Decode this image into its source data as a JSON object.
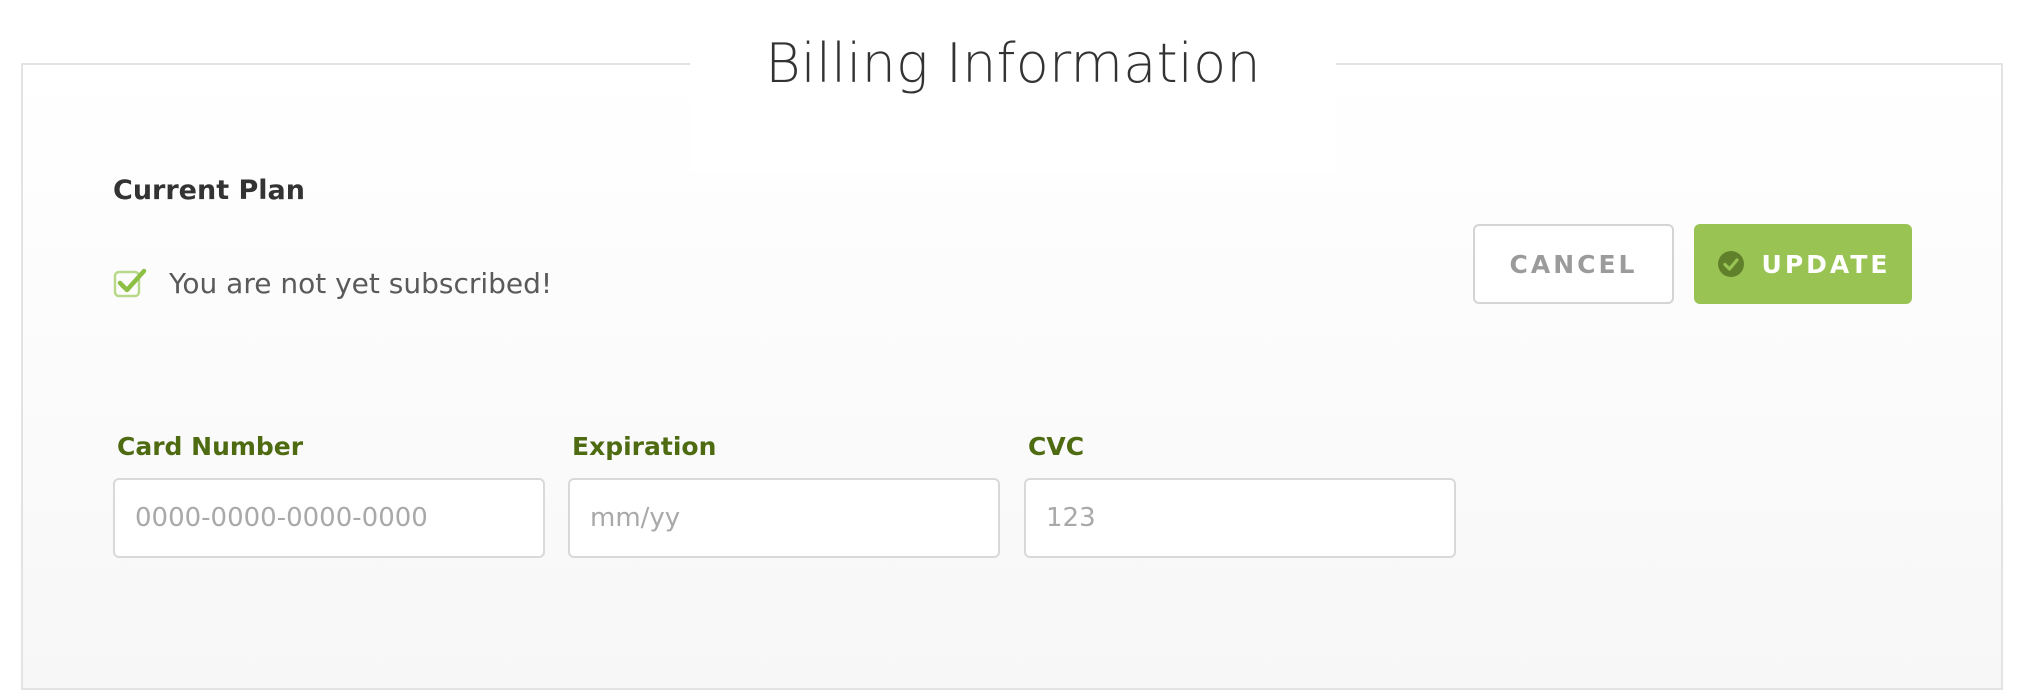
{
  "header": {
    "title": "Billing Information"
  },
  "plan": {
    "heading": "Current Plan",
    "status_text": "You are not yet subscribed!",
    "status_icon": "checkbox-check-icon"
  },
  "actions": {
    "cancel_label": "CANCEL",
    "update_label": "UPDATE",
    "update_icon": "check-circle-icon"
  },
  "form": {
    "card_number": {
      "label": "Card Number",
      "value": "",
      "placeholder": "0000-0000-0000-0000"
    },
    "expiration": {
      "label": "Expiration",
      "value": "",
      "placeholder": "mm/yy"
    },
    "cvc": {
      "label": "CVC",
      "value": "",
      "placeholder": "123"
    }
  },
  "colors": {
    "accent": "#99c454",
    "label_green": "#4e6b12",
    "border": "#e3e3e3",
    "text_dark": "#333333"
  }
}
